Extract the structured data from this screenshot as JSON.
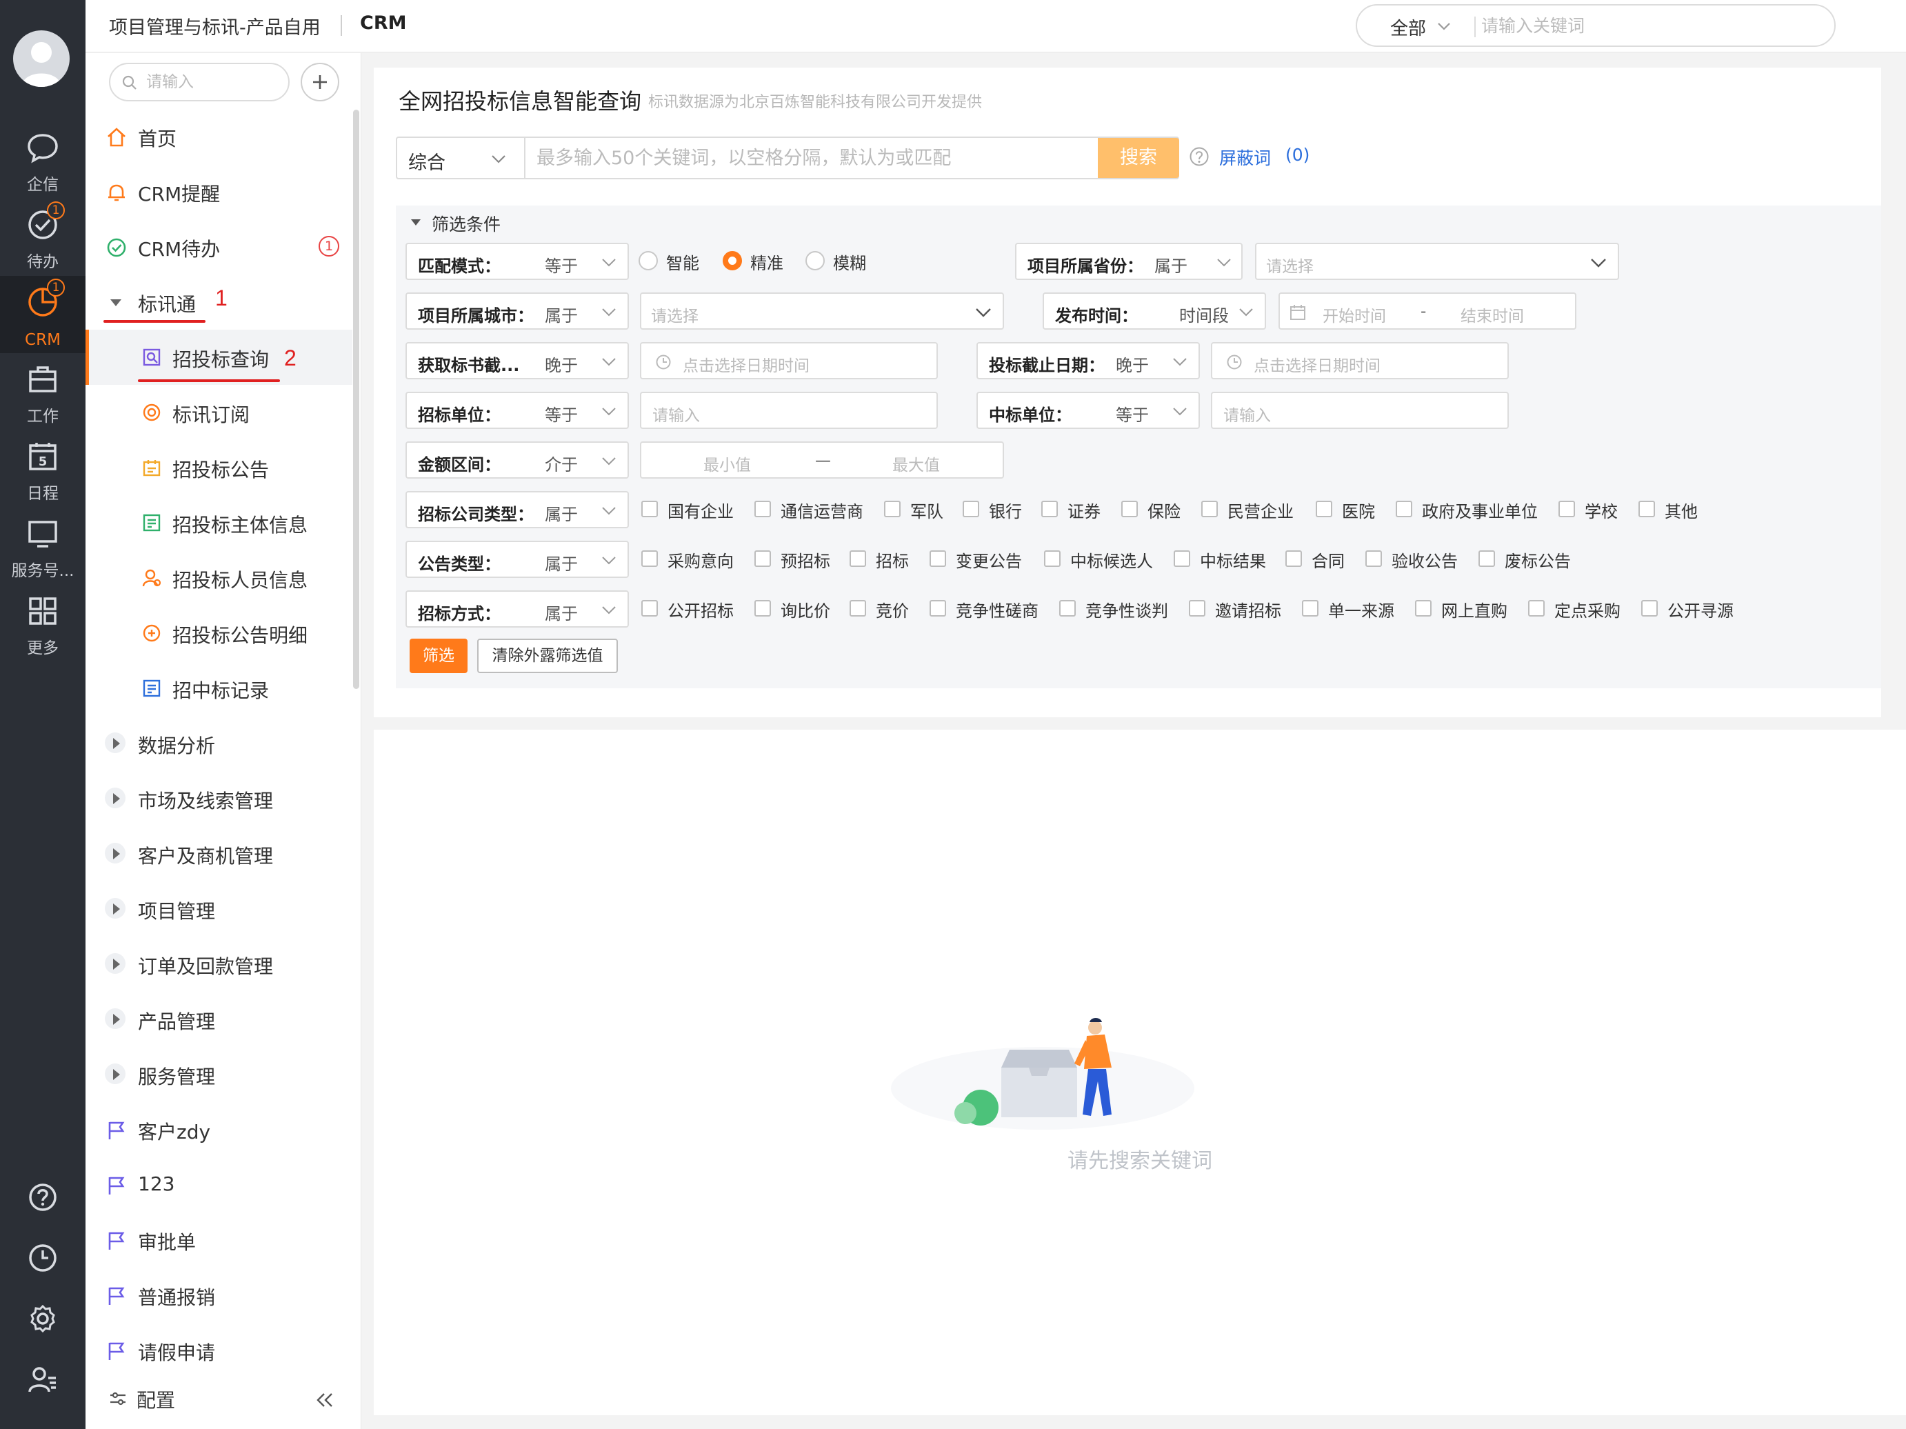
{
  "rail": {
    "items": [
      {
        "label": "企信",
        "icon": "chat-icon"
      },
      {
        "label": "待办",
        "icon": "check-circle-icon",
        "badge": "1"
      },
      {
        "label": "CRM",
        "icon": "pie-chart-icon",
        "badge": "1",
        "active": true
      },
      {
        "label": "工作",
        "icon": "briefcase-icon"
      },
      {
        "label": "日程",
        "icon": "calendar-icon",
        "day": "5"
      },
      {
        "label": "服务号...",
        "icon": "monitor-icon"
      },
      {
        "label": "更多",
        "icon": "grid-icon"
      }
    ],
    "bottom": [
      "help-icon",
      "clock-icon",
      "settings-icon",
      "user-manage-icon"
    ]
  },
  "topbar": {
    "breadcrumb": "项目管理与标讯-产品自用",
    "app": "CRM",
    "search_scope": "全部",
    "search_placeholder": "请输入关键词"
  },
  "sidebar": {
    "search_placeholder": "请输入",
    "items": [
      {
        "label": "首页",
        "icon": "home-icon"
      },
      {
        "label": "CRM提醒",
        "icon": "bell-icon"
      },
      {
        "label": "CRM待办",
        "icon": "check-icon",
        "badge": "1"
      },
      {
        "label": "标讯通",
        "expanded": true
      },
      {
        "label": "招投标查询",
        "icon": "bid-search-icon",
        "selected": true
      },
      {
        "label": "标讯订阅",
        "icon": "subscribe-icon"
      },
      {
        "label": "招投标公告",
        "icon": "notice-icon"
      },
      {
        "label": "招投标主体信息",
        "icon": "entity-icon"
      },
      {
        "label": "招投标人员信息",
        "icon": "person-icon"
      },
      {
        "label": "招投标公告明细",
        "icon": "detail-icon"
      },
      {
        "label": "招中标记录",
        "icon": "record-icon"
      },
      {
        "label": "数据分析"
      },
      {
        "label": "市场及线索管理"
      },
      {
        "label": "客户及商机管理"
      },
      {
        "label": "项目管理"
      },
      {
        "label": "订单及回款管理"
      },
      {
        "label": "产品管理"
      },
      {
        "label": "服务管理"
      },
      {
        "label": "客户zdy",
        "icon": "flag-icon"
      },
      {
        "label": "123",
        "icon": "flag-icon"
      },
      {
        "label": "审批单",
        "icon": "flag-icon"
      },
      {
        "label": "普通报销",
        "icon": "flag-icon"
      },
      {
        "label": "请假申请",
        "icon": "flag-icon"
      }
    ],
    "config_label": "配置",
    "annotations": [
      "1",
      "2"
    ]
  },
  "main": {
    "title": "全网招投标信息智能查询",
    "subtitle": "标讯数据源为北京百炼智能科技有限公司开发提供",
    "query_type": "综合",
    "query_placeholder": "最多输入50个关键词，以空格分隔，默认为或匹配",
    "search_btn": "搜索",
    "block_words": "屏蔽词",
    "block_count": "(0)",
    "filter": {
      "title": "筛选条件",
      "match_mode": {
        "key": "匹配模式：",
        "op": "等于",
        "options": [
          "智能",
          "精准",
          "模糊"
        ],
        "selected": 1
      },
      "province": {
        "key": "项目所属省份：",
        "op": "属于",
        "placeholder": "请选择"
      },
      "city": {
        "key": "项目所属城市：",
        "op": "属于",
        "placeholder": "请选择"
      },
      "publish_time": {
        "key": "发布时间：",
        "op": "时间段",
        "start": "开始时间",
        "dash": "-",
        "end": "结束时间"
      },
      "doc_deadline": {
        "key": "获取标书截...",
        "op": "晚于",
        "placeholder": "点击选择日期时间"
      },
      "bid_deadline": {
        "key": "投标截止日期：",
        "op": "晚于",
        "placeholder": "点击选择日期时间"
      },
      "tender_unit": {
        "key": "招标单位：",
        "op": "等于",
        "placeholder": "请输入"
      },
      "winner_unit": {
        "key": "中标单位：",
        "op": "等于",
        "placeholder": "请输入"
      },
      "amount": {
        "key": "金额区间：",
        "op": "介于",
        "min": "最小值",
        "dash": "—",
        "max": "最大值"
      },
      "company_type": {
        "key": "招标公司类型：",
        "op": "属于",
        "options": [
          "国有企业",
          "通信运营商",
          "军队",
          "银行",
          "证券",
          "保险",
          "民营企业",
          "医院",
          "政府及事业单位",
          "学校",
          "其他"
        ]
      },
      "notice_type": {
        "key": "公告类型：",
        "op": "属于",
        "options": [
          "采购意向",
          "预招标",
          "招标",
          "变更公告",
          "中标候选人",
          "中标结果",
          "合同",
          "验收公告",
          "废标公告"
        ]
      },
      "method": {
        "key": "招标方式：",
        "op": "属于",
        "options": [
          "公开招标",
          "询比价",
          "竞价",
          "竞争性磋商",
          "竞争性谈判",
          "邀请招标",
          "单一来源",
          "网上直购",
          "定点采购",
          "公开寻源"
        ]
      },
      "apply_btn": "筛选",
      "clear_btn": "清除外露筛选值"
    },
    "empty_text": "请先搜索关键词"
  }
}
